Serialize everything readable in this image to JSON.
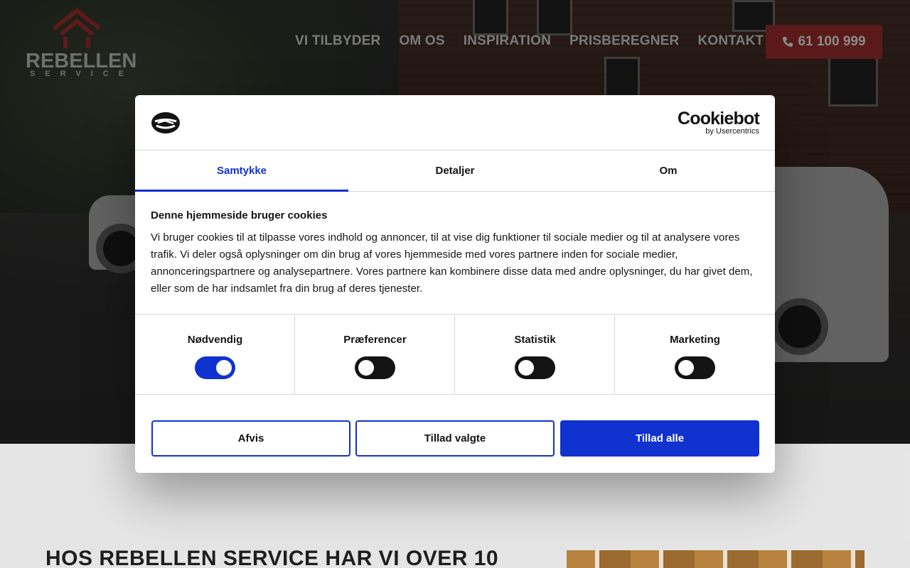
{
  "site": {
    "logo_text": "REBELLEN",
    "logo_sub": "SERVICE",
    "nav": [
      "VI TILBYDER",
      "OM OS",
      "INSPIRATION",
      "PRISBEREGNER",
      "KONTAKT"
    ],
    "phone": "61 100 999",
    "headline": "HOS REBELLEN SERVICE HAR VI OVER 10"
  },
  "cookie_dialog": {
    "brand": "Cookiebot",
    "brand_sub": "by Usercentrics",
    "tabs": [
      "Samtykke",
      "Detaljer",
      "Om"
    ],
    "active_tab": "Samtykke",
    "title": "Denne hjemmeside bruger cookies",
    "text": "Vi bruger cookies til at tilpasse vores indhold og annoncer, til at vise dig funktioner til sociale medier og til at analysere vores trafik. Vi deler også oplysninger om din brug af vores hjemmeside med vores partnere inden for sociale medier, annonceringspartnere og analysepartnere. Vores partnere kan kombinere disse data med andre oplysninger, du har givet dem, eller som de har indsamlet fra din brug af deres tjenester.",
    "categories": [
      {
        "label": "Nødvendig",
        "enabled": true
      },
      {
        "label": "Præferencer",
        "enabled": false
      },
      {
        "label": "Statistik",
        "enabled": false
      },
      {
        "label": "Marketing",
        "enabled": false
      }
    ],
    "buttons": {
      "decline": "Afvis",
      "allow_selected": "Tillad valgte",
      "allow_all": "Tillad alle"
    }
  },
  "colors": {
    "accent": "#1032cf",
    "phone_bg": "#5a1a1a",
    "nav_text": "#7a7a7a"
  }
}
